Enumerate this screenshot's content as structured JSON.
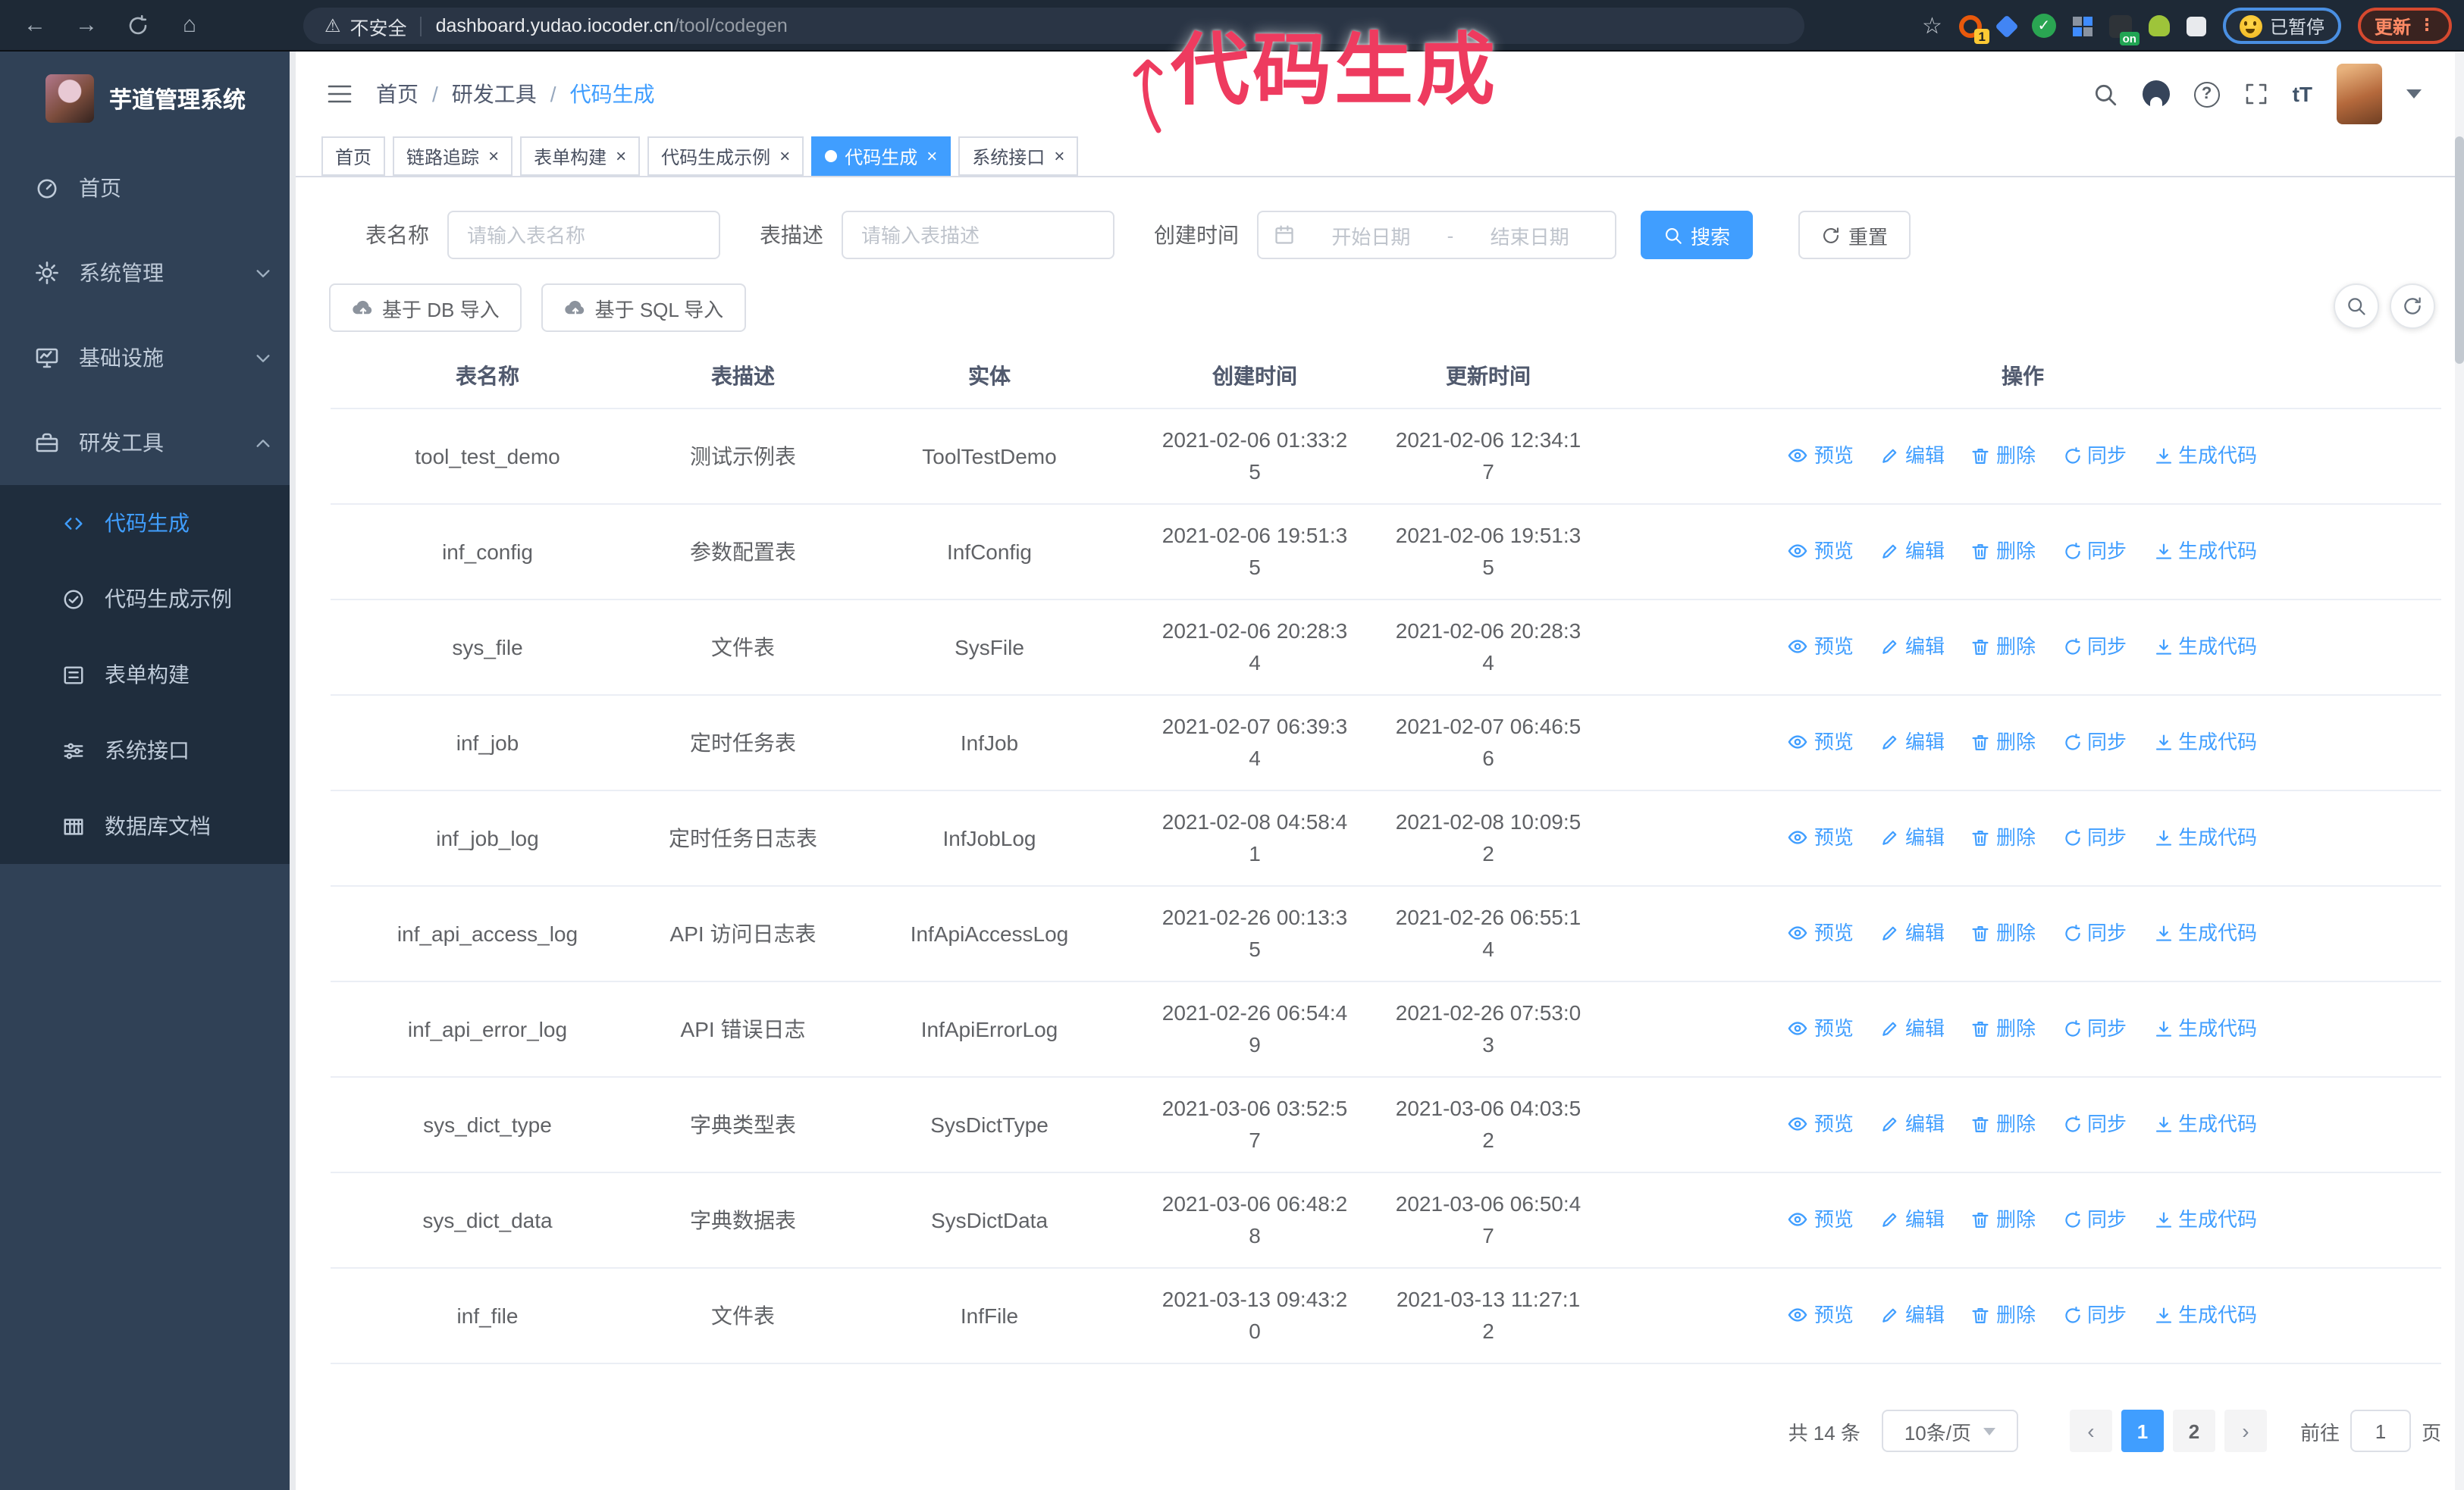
{
  "browser": {
    "security_label": "不安全",
    "url_host": "dashboard.yudao.iocoder.cn",
    "url_path": "/tool/codegen",
    "extension_badge": "1",
    "extension_on_badge": "on",
    "paused_label": "已暂停",
    "update_label": "更新"
  },
  "annotation": {
    "text": "代码生成",
    "color": "#ee3b5f"
  },
  "sidebar": {
    "title": "芋道管理系统",
    "items": [
      {
        "label": "首页"
      },
      {
        "label": "系统管理"
      },
      {
        "label": "基础设施"
      },
      {
        "label": "研发工具"
      }
    ],
    "submenu": [
      {
        "label": "代码生成",
        "active": true
      },
      {
        "label": "代码生成示例"
      },
      {
        "label": "表单构建"
      },
      {
        "label": "系统接口"
      },
      {
        "label": "数据库文档"
      }
    ]
  },
  "header": {
    "breadcrumb": [
      "首页",
      "研发工具",
      "代码生成"
    ]
  },
  "tabs": [
    {
      "label": "首页",
      "closable": false,
      "active": false
    },
    {
      "label": "链路追踪",
      "closable": true,
      "active": false
    },
    {
      "label": "表单构建",
      "closable": true,
      "active": false
    },
    {
      "label": "代码生成示例",
      "closable": true,
      "active": false
    },
    {
      "label": "代码生成",
      "closable": true,
      "active": true
    },
    {
      "label": "系统接口",
      "closable": true,
      "active": false
    }
  ],
  "filters": {
    "table_name_label": "表名称",
    "table_name_placeholder": "请输入表名称",
    "table_desc_label": "表描述",
    "table_desc_placeholder": "请输入表描述",
    "create_time_label": "创建时间",
    "date_start_placeholder": "开始日期",
    "date_separator": "-",
    "date_end_placeholder": "结束日期",
    "search_label": "搜索",
    "reset_label": "重置"
  },
  "toolbar": {
    "import_db_label": "基于 DB 导入",
    "import_sql_label": "基于 SQL 导入"
  },
  "table": {
    "columns": [
      "表名称",
      "表描述",
      "实体",
      "创建时间",
      "更新时间",
      "操作"
    ],
    "actions": [
      {
        "label": "预览",
        "icon": "eye"
      },
      {
        "label": "编辑",
        "icon": "edit"
      },
      {
        "label": "删除",
        "icon": "delete"
      },
      {
        "label": "同步",
        "icon": "sync"
      },
      {
        "label": "生成代码",
        "icon": "download"
      }
    ],
    "rows": [
      {
        "name": "tool_test_demo",
        "desc": "测试示例表",
        "entity": "ToolTestDemo",
        "created": "2021-02-06 01:33:25",
        "updated": "2021-02-06 12:34:17"
      },
      {
        "name": "inf_config",
        "desc": "参数配置表",
        "entity": "InfConfig",
        "created": "2021-02-06 19:51:35",
        "updated": "2021-02-06 19:51:35"
      },
      {
        "name": "sys_file",
        "desc": "文件表",
        "entity": "SysFile",
        "created": "2021-02-06 20:28:34",
        "updated": "2021-02-06 20:28:34"
      },
      {
        "name": "inf_job",
        "desc": "定时任务表",
        "entity": "InfJob",
        "created": "2021-02-07 06:39:34",
        "updated": "2021-02-07 06:46:56"
      },
      {
        "name": "inf_job_log",
        "desc": "定时任务日志表",
        "entity": "InfJobLog",
        "created": "2021-02-08 04:58:41",
        "updated": "2021-02-08 10:09:52"
      },
      {
        "name": "inf_api_access_log",
        "desc": "API 访问日志表",
        "entity": "InfApiAccessLog",
        "created": "2021-02-26 00:13:35",
        "updated": "2021-02-26 06:55:14"
      },
      {
        "name": "inf_api_error_log",
        "desc": "API 错误日志",
        "entity": "InfApiErrorLog",
        "created": "2021-02-26 06:54:49",
        "updated": "2021-02-26 07:53:03"
      },
      {
        "name": "sys_dict_type",
        "desc": "字典类型表",
        "entity": "SysDictType",
        "created": "2021-03-06 03:52:57",
        "updated": "2021-03-06 04:03:52"
      },
      {
        "name": "sys_dict_data",
        "desc": "字典数据表",
        "entity": "SysDictData",
        "created": "2021-03-06 06:48:28",
        "updated": "2021-03-06 06:50:47"
      },
      {
        "name": "inf_file",
        "desc": "文件表",
        "entity": "InfFile",
        "created": "2021-03-13 09:43:20",
        "updated": "2021-03-13 11:27:12"
      }
    ]
  },
  "pagination": {
    "total_label": "共 14 条",
    "page_size_value": "10条/页",
    "pages": [
      "1",
      "2"
    ],
    "active_page": "1",
    "goto_label": "前往",
    "goto_page": "1",
    "goto_unit": "页"
  },
  "colors": {
    "accent": "#409eff",
    "sidebar_bg": "#304156",
    "submenu_bg": "#1f2d3d",
    "chrome_bg": "#1e2936",
    "annotation": "#ee3b5f"
  }
}
